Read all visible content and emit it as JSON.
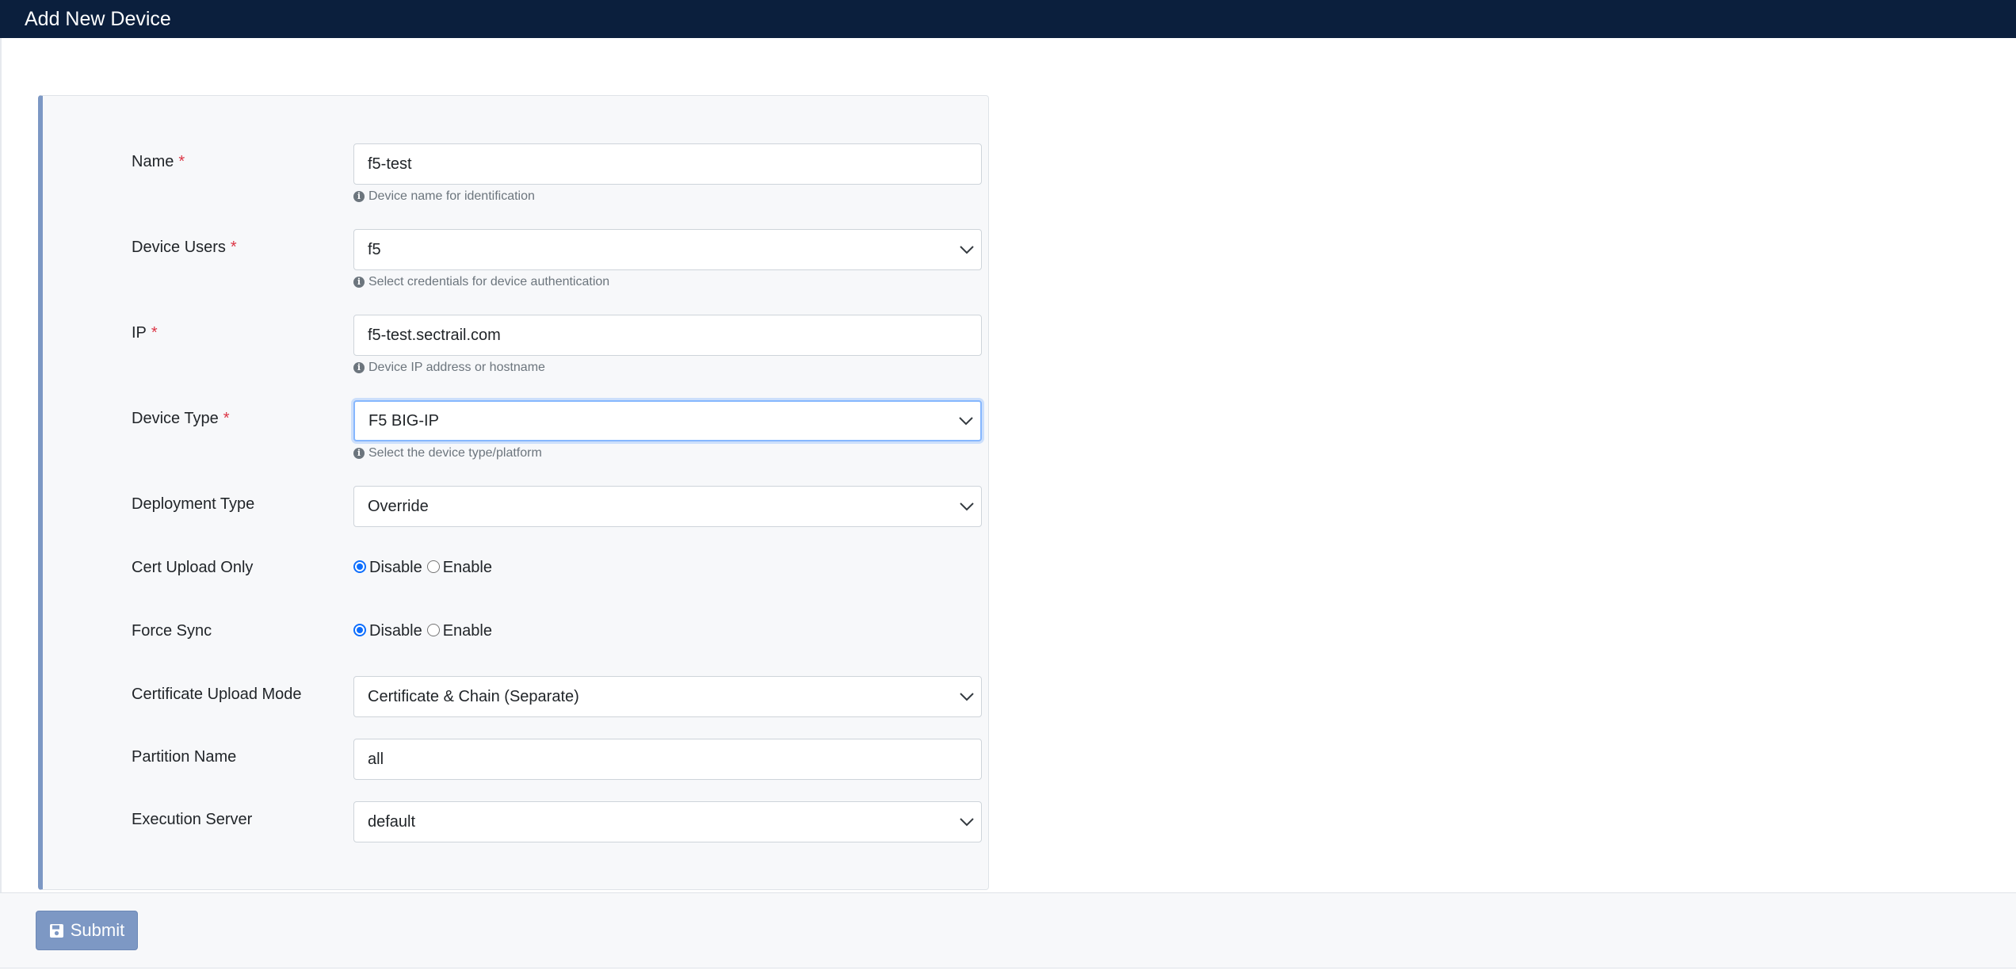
{
  "header": {
    "title": "Add New Device"
  },
  "form": {
    "name": {
      "label": "Name",
      "required_mark": "*",
      "value": "f5-test",
      "help": "Device name for identification"
    },
    "device_users": {
      "label": "Device Users",
      "required_mark": "*",
      "value": "f5",
      "help": "Select credentials for device authentication"
    },
    "ip": {
      "label": "IP",
      "required_mark": "*",
      "value": "f5-test.sectrail.com",
      "help": "Device IP address or hostname"
    },
    "device_type": {
      "label": "Device Type",
      "required_mark": "*",
      "value": "F5 BIG-IP",
      "help": "Select the device type/platform"
    },
    "deployment_type": {
      "label": "Deployment Type",
      "value": "Override"
    },
    "cert_upload_only": {
      "label": "Cert Upload Only",
      "options": [
        "Disable",
        "Enable"
      ],
      "selected": "Disable"
    },
    "force_sync": {
      "label": "Force Sync",
      "options": [
        "Disable",
        "Enable"
      ],
      "selected": "Disable"
    },
    "certificate_upload_mode": {
      "label": "Certificate Upload Mode",
      "value": "Certificate & Chain (Separate)"
    },
    "partition_name": {
      "label": "Partition Name",
      "value": "all"
    },
    "execution_server": {
      "label": "Execution Server",
      "value": "default"
    }
  },
  "footer": {
    "submit_label": "Submit"
  },
  "icons": {
    "info": "info-circle-icon",
    "dropdown": "chevron-down-icon",
    "save": "floppy-disk-icon"
  },
  "colors": {
    "header_bg": "#0b1f3d",
    "card_accent": "#7c98c4",
    "required": "#dc3545",
    "submit_bg": "#7d98c4",
    "radio_checked": "#0d6efd"
  }
}
